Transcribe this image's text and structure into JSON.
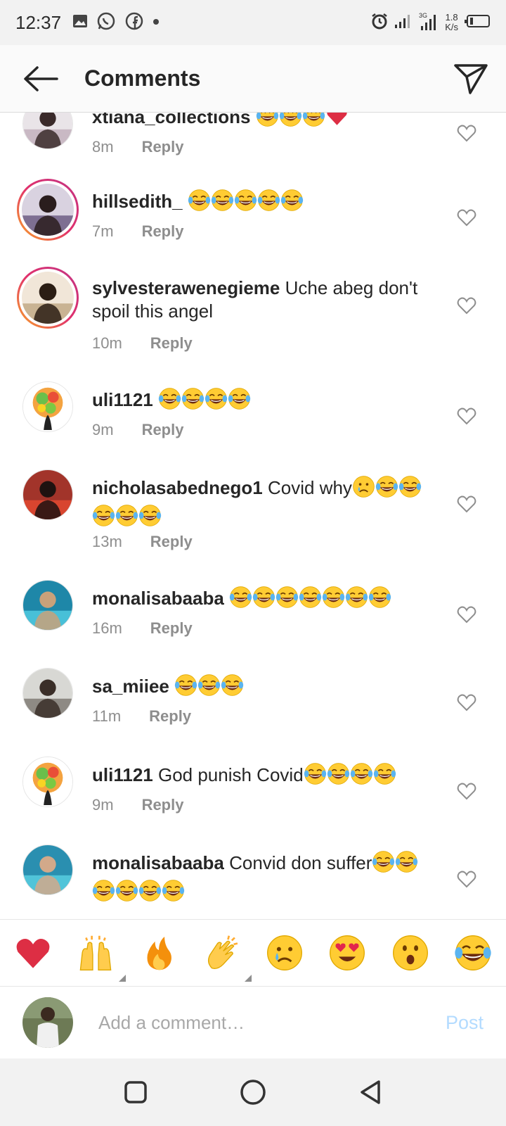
{
  "status_bar": {
    "time": "12:37",
    "net_speed_value": "1.8",
    "net_speed_unit": "K/s",
    "network_type": "3G"
  },
  "header": {
    "title": "Comments"
  },
  "comments": [
    {
      "username": "xtiana_collections",
      "text": "",
      "emojis": [
        "joy",
        "joy",
        "joy",
        "red-heart"
      ],
      "time": "8m",
      "reply_label": "Reply",
      "avatar": "photo",
      "ring": false
    },
    {
      "username": "hillsedith_",
      "text": "",
      "emojis": [
        "joy",
        "joy",
        "joy",
        "joy",
        "joy"
      ],
      "time": "7m",
      "reply_label": "Reply",
      "avatar": "photo",
      "ring": true
    },
    {
      "username": "sylvesterawenegieme",
      "text": "Uche abeg don't spoil this angel",
      "emojis": [],
      "time": "10m",
      "reply_label": "Reply",
      "avatar": "photo",
      "ring": true
    },
    {
      "username": "uli1121",
      "text": "",
      "emojis": [
        "joy",
        "joy",
        "joy",
        "joy"
      ],
      "time": "9m",
      "reply_label": "Reply",
      "avatar": "illustration",
      "ring": false
    },
    {
      "username": "nicholasabednego1",
      "text": "Covid why",
      "emojis": [
        "crying",
        "joy",
        "joy",
        "joy",
        "joy",
        "joy"
      ],
      "time": "13m",
      "reply_label": "Reply",
      "avatar": "photo",
      "ring": false
    },
    {
      "username": "monalisabaaba",
      "text": "",
      "emojis": [
        "joy",
        "joy",
        "joy",
        "joy",
        "joy",
        "joy",
        "joy"
      ],
      "time": "16m",
      "reply_label": "Reply",
      "avatar": "photo",
      "ring": false
    },
    {
      "username": "sa_miiee",
      "text": "",
      "emojis": [
        "joy",
        "joy",
        "joy"
      ],
      "time": "11m",
      "reply_label": "Reply",
      "avatar": "photo",
      "ring": false
    },
    {
      "username": "uli1121",
      "text": "God punish Covid",
      "emojis": [
        "joy",
        "joy",
        "joy",
        "joy"
      ],
      "time": "9m",
      "reply_label": "Reply",
      "avatar": "illustration",
      "ring": false
    },
    {
      "username": "monalisabaaba",
      "text": "Convid don suffer",
      "emojis": [
        "joy",
        "joy",
        "joy",
        "joy",
        "joy",
        "joy"
      ],
      "time": "",
      "reply_label": "",
      "avatar": "photo",
      "ring": false
    }
  ],
  "reaction_bar": [
    "red-heart",
    "raised-hands",
    "fire",
    "clapping-hands",
    "crying-face",
    "heart-eyes-face",
    "astonished-face",
    "tears-of-joy-face"
  ],
  "comment_input": {
    "placeholder": "Add a comment…",
    "post_label": "Post"
  },
  "colors": {
    "accent_post": "#b3dbff",
    "secondary_text": "#8e8e8e",
    "story_ring": "#e1306c"
  }
}
